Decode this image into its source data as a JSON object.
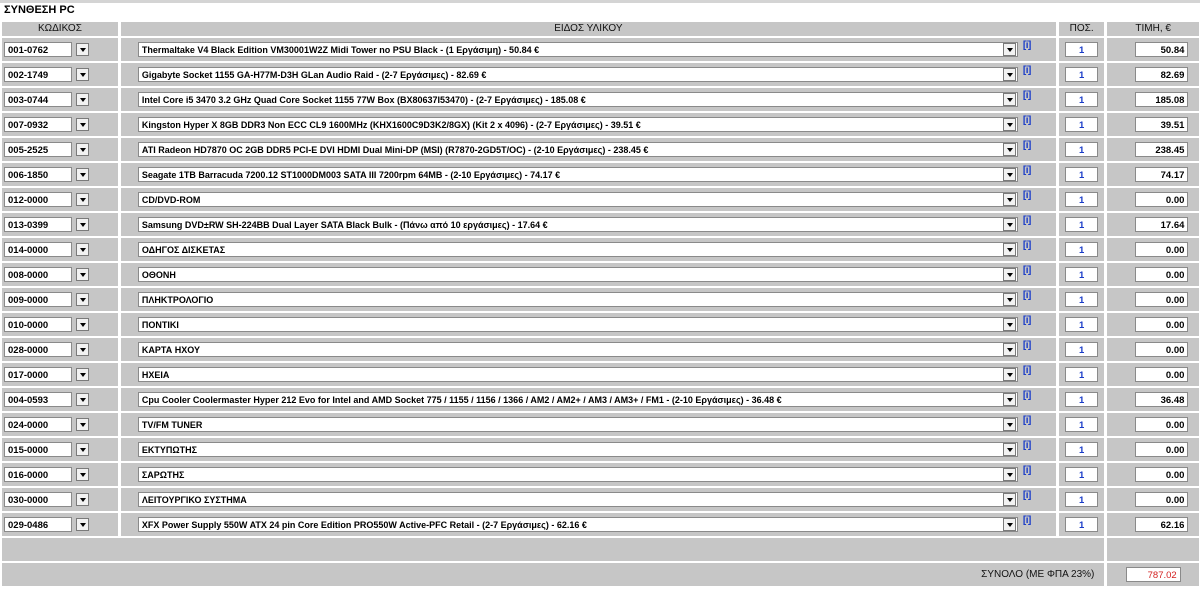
{
  "title": "ΣΥΝΘΕΣΗ PC",
  "headers": {
    "code": "ΚΩΔΙΚΟΣ",
    "item": "ΕΙΔΟΣ ΥΛΙΚΟΥ",
    "qty": "ΠΟΣ.",
    "price": "ΤΙΜΗ, €"
  },
  "info_label": "[i]",
  "rows": [
    {
      "code": "001-0762",
      "desc": "Thermaltake V4 Black Edition VM30001W2Z Midi Tower no PSU Black - (1 Εργάσιμη) - 50.84 €",
      "qty": "1",
      "price": "50.84"
    },
    {
      "code": "002-1749",
      "desc": "Gigabyte Socket 1155 GA-H77M-D3H GLan Audio Raid - (2-7 Εργάσιμες) - 82.69 €",
      "qty": "1",
      "price": "82.69"
    },
    {
      "code": "003-0744",
      "desc": "Intel Core i5 3470 3.2 GHz Quad Core Socket 1155 77W Box (BX80637I53470) - (2-7 Εργάσιμες) - 185.08 €",
      "qty": "1",
      "price": "185.08"
    },
    {
      "code": "007-0932",
      "desc": "Kingston Hyper X 8GB DDR3 Non ECC CL9 1600MHz (KHX1600C9D3K2/8GX) (Kit 2 x 4096) - (2-7 Εργάσιμες) - 39.51 €",
      "qty": "1",
      "price": "39.51"
    },
    {
      "code": "005-2525",
      "desc": "ATI Radeon HD7870 OC 2GB DDR5 PCI-E DVI HDMI Dual Mini-DP (MSI) (R7870-2GD5T/OC) - (2-10 Εργάσιμες) - 238.45 €",
      "qty": "1",
      "price": "238.45"
    },
    {
      "code": "006-1850",
      "desc": "Seagate 1TB Barracuda 7200.12 ST1000DM003 SATA III 7200rpm 64MB - (2-10 Εργάσιμες) - 74.17 €",
      "qty": "1",
      "price": "74.17"
    },
    {
      "code": "012-0000",
      "desc": "CD/DVD-ROM",
      "qty": "1",
      "price": "0.00"
    },
    {
      "code": "013-0399",
      "desc": "Samsung DVD±RW SH-224BB Dual Layer SATA Black Bulk - (Πάνω από 10 εργάσιμες) - 17.64 €",
      "qty": "1",
      "price": "17.64"
    },
    {
      "code": "014-0000",
      "desc": "ΟΔΗΓΟΣ ΔΙΣΚΕΤΑΣ",
      "qty": "1",
      "price": "0.00"
    },
    {
      "code": "008-0000",
      "desc": "ΟΘΟΝΗ",
      "qty": "1",
      "price": "0.00"
    },
    {
      "code": "009-0000",
      "desc": "ΠΛΗΚΤΡΟΛΟΓΙΟ",
      "qty": "1",
      "price": "0.00"
    },
    {
      "code": "010-0000",
      "desc": "ΠΟΝΤΙΚΙ",
      "qty": "1",
      "price": "0.00"
    },
    {
      "code": "028-0000",
      "desc": "ΚΑΡΤΑ ΗΧΟΥ",
      "qty": "1",
      "price": "0.00"
    },
    {
      "code": "017-0000",
      "desc": "ΗΧΕΙΑ",
      "qty": "1",
      "price": "0.00"
    },
    {
      "code": "004-0593",
      "desc": "Cpu Cooler Coolermaster Hyper 212 Evo for Intel and AMD Socket 775 / 1155 / 1156 / 1366 / AM2 / AM2+ / AM3 / AM3+ / FM1 - (2-10 Εργάσιμες) - 36.48 €",
      "qty": "1",
      "price": "36.48"
    },
    {
      "code": "024-0000",
      "desc": "TV/FM TUNER",
      "qty": "1",
      "price": "0.00"
    },
    {
      "code": "015-0000",
      "desc": "ΕΚΤΥΠΩΤΗΣ",
      "qty": "1",
      "price": "0.00"
    },
    {
      "code": "016-0000",
      "desc": "ΣΑΡΩΤΗΣ",
      "qty": "1",
      "price": "0.00"
    },
    {
      "code": "030-0000",
      "desc": "ΛΕΙΤΟΥΡΓΙΚΟ ΣΥΣΤΗΜΑ",
      "qty": "1",
      "price": "0.00"
    },
    {
      "code": "029-0486",
      "desc": "XFX Power Supply 550W ATX 24 pin Core Edition PRO550W Active-PFC Retail - (2-7 Εργάσιμες) - 62.16 €",
      "qty": "1",
      "price": "62.16"
    }
  ],
  "total": {
    "label": "ΣΥΝΟΛΟ (ΜΕ ΦΠΑ 23%)",
    "value": "787.02"
  },
  "colors": {
    "cell_bg": "#c6c6c6",
    "info_link": "#1a3cc8",
    "total_value": "#d42020"
  }
}
